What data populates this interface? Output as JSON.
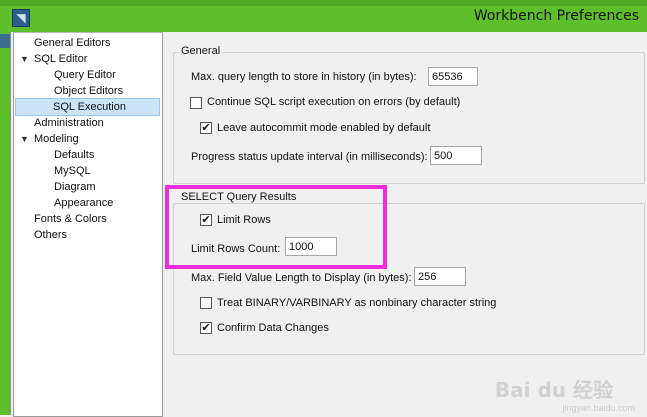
{
  "window": {
    "title": "Workbench Preferences"
  },
  "tree": [
    {
      "label": "General Editors",
      "expander": "",
      "indent": 0
    },
    {
      "label": "SQL Editor",
      "expander": "▼",
      "indent": 0
    },
    {
      "label": "Query Editor",
      "expander": "",
      "indent": 1
    },
    {
      "label": "Object Editors",
      "expander": "",
      "indent": 1
    },
    {
      "label": "SQL Execution",
      "expander": "",
      "indent": 1,
      "selected": true
    },
    {
      "label": "Administration",
      "expander": "",
      "indent": 0
    },
    {
      "label": "Modeling",
      "expander": "▼",
      "indent": 0
    },
    {
      "label": "Defaults",
      "expander": "",
      "indent": 1
    },
    {
      "label": "MySQL",
      "expander": "",
      "indent": 1
    },
    {
      "label": "Diagram",
      "expander": "",
      "indent": 1
    },
    {
      "label": "Appearance",
      "expander": "",
      "indent": 1
    },
    {
      "label": "Fonts & Colors",
      "expander": "",
      "indent": 0
    },
    {
      "label": "Others",
      "expander": "",
      "indent": 0
    }
  ],
  "general": {
    "heading": "General",
    "max_query_label": "Max. query length to store in history (in bytes):",
    "max_query_value": "65536",
    "continue_on_error_label": "Continue SQL script execution on errors (by default)",
    "continue_on_error_checked": false,
    "autocommit_label": "Leave autocommit mode enabled by default",
    "autocommit_checked": true,
    "progress_label": "Progress status update interval (in milliseconds):",
    "progress_value": "500"
  },
  "select_results": {
    "heading": "SELECT Query Results",
    "limit_rows_label": "Limit Rows",
    "limit_rows_checked": true,
    "limit_rows_count_label": "Limit Rows Count:",
    "limit_rows_count_value": "1000",
    "max_field_label": "Max. Field Value Length to Display (in bytes):",
    "max_field_value": "256",
    "binary_label": "Treat BINARY/VARBINARY as nonbinary character string",
    "binary_checked": false,
    "confirm_label": "Confirm Data Changes",
    "confirm_checked": true
  },
  "watermark": {
    "text": "Bai du 经验",
    "sub": "jingyan.baidu.com"
  },
  "colors": {
    "titlebar": "#5fbf2a",
    "highlight": "#ee2ddc",
    "selection": "#cce4f7"
  },
  "icons": {
    "app": "mysql-workbench-icon",
    "check": "checkmark-icon",
    "expander": "triangle-down-icon"
  }
}
